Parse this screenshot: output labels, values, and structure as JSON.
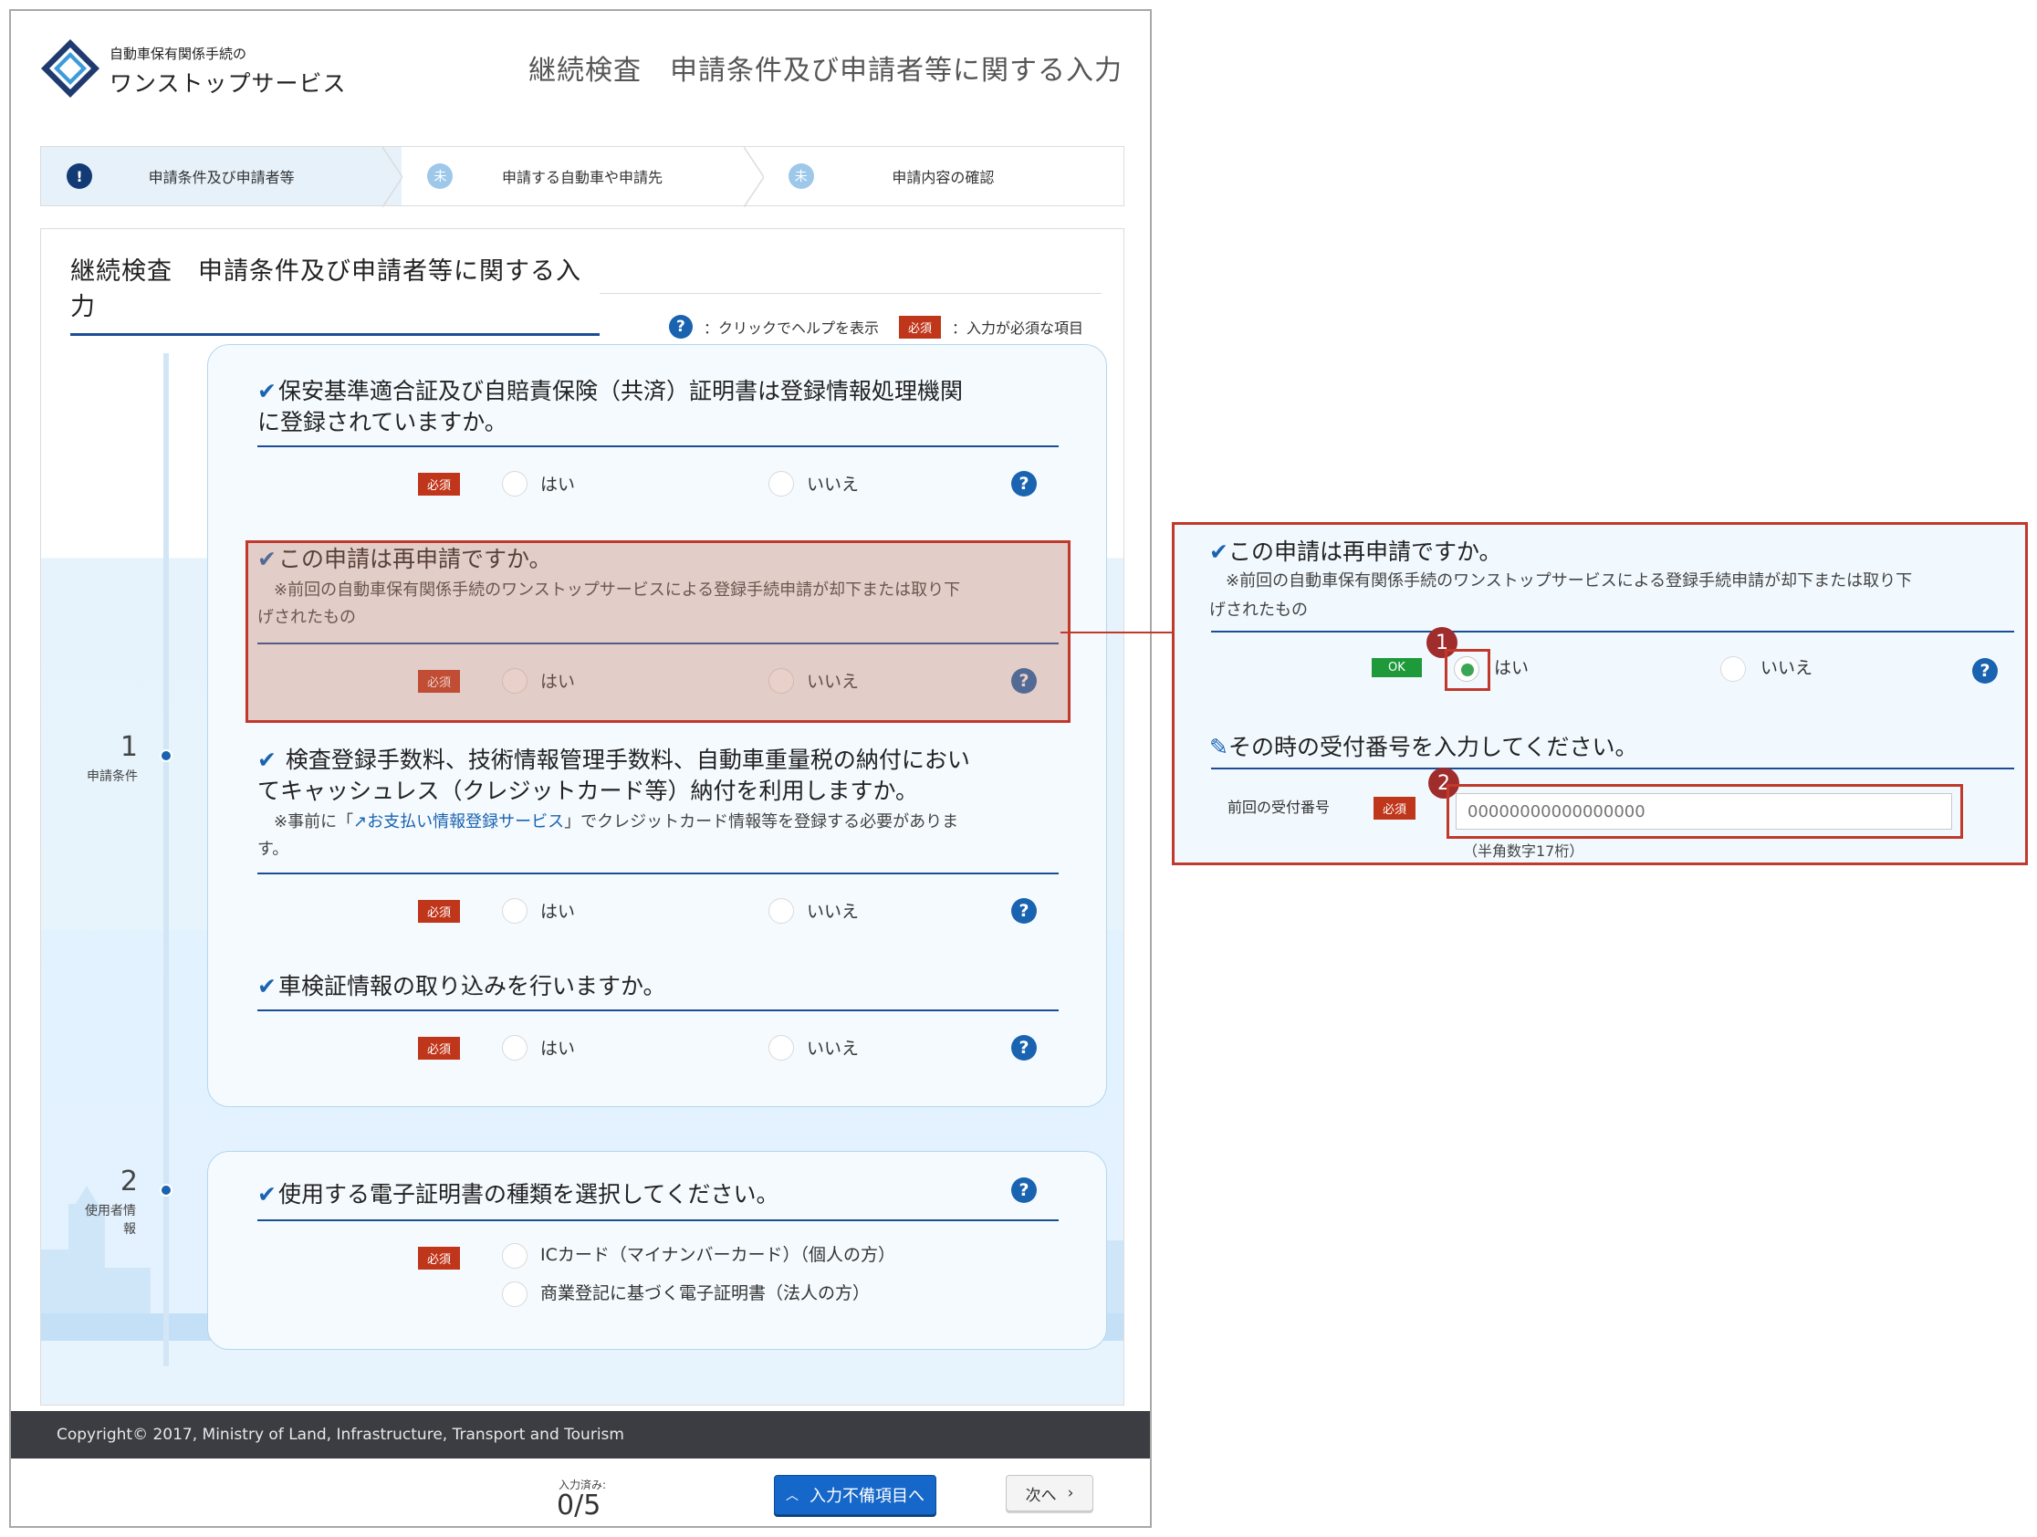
{
  "header": {
    "logo_small": "自動車保有関係手続の",
    "logo_big": "ワンストップサービス",
    "page_title": "継続検査　申請条件及び申請者等に関する入力"
  },
  "stepper": [
    {
      "badge": "!",
      "label": "申請条件及び申請者等",
      "state": "current"
    },
    {
      "badge": "未",
      "label": "申請する自動車や申請先",
      "state": "todo"
    },
    {
      "badge": "未",
      "label": "申請内容の確認",
      "state": "todo"
    }
  ],
  "section": {
    "title": "継続検査　申請条件及び申請者等に関する入力",
    "legend_help": "：クリックでヘルプを表示",
    "legend_required_tag": "必須",
    "legend_required": "：入力が必須な項目"
  },
  "timeline": [
    {
      "num": "1",
      "label": "申請条件"
    },
    {
      "num": "2",
      "label": "使用者情報"
    }
  ],
  "questions": {
    "q1": {
      "line1": "保安基準適合証及び自賠責保険（共済）証明書は登録情報処理機関",
      "line2": "に登録されていますか。"
    },
    "q2": {
      "title": "この申請は再申請ですか。",
      "note1": "　※前回の自動車保有関係手続のワンストップサービスによる登録手続申請が却下または取り下",
      "note2": "げされたもの"
    },
    "q3": {
      "line1": "検査登録手数料、技術情報管理手数料、自動車重量税の納付におい",
      "line2": "てキャッシュレス（クレジットカード等）納付を利用しますか。",
      "note_pre": "　※事前に「",
      "note_link": "お支払い情報登録サービス",
      "note_post": "」でクレジットカード情報等を登録する必要がありま",
      "note_line2": "す。"
    },
    "q4": {
      "title": "車検証情報の取り込みを行いますか。"
    },
    "q5": {
      "title": "使用する電子証明書の種類を選択してください。",
      "opt1": "ICカード（マイナンバーカード）（個人の方）",
      "opt2": "商業登記に基づく電子証明書（法人の方）"
    }
  },
  "common": {
    "required": "必須",
    "yes": "はい",
    "no": "いいえ",
    "help": "?",
    "check": "✔"
  },
  "footer": {
    "copyright": "Copyright© 2017, Ministry of Land, Infrastructure, Transport and Tourism",
    "progress_label": "入力済み:",
    "progress_value": "0/5",
    "btn_missing": "入力不備項目へ",
    "btn_next": "次へ"
  },
  "zoom": {
    "title": "この申請は再申請ですか。",
    "note1": "　※前回の自動車保有関係手続のワンストップサービスによる登録手続申請が却下または取り下",
    "note2": "げされたもの",
    "ok_tag": "OK",
    "badge1": "1",
    "badge2": "2",
    "sub_title": "その時の受付番号を入力してください。",
    "field_label": "前回の受付番号",
    "placeholder": "00000000000000000",
    "hint": "（半角数字17桁）"
  },
  "colors": {
    "brand_navy": "#1b4d96",
    "link_blue": "#1a63b0",
    "required_red": "#c0361b",
    "ok_green": "#1f9a3a",
    "annotation_red": "#c0392b"
  }
}
